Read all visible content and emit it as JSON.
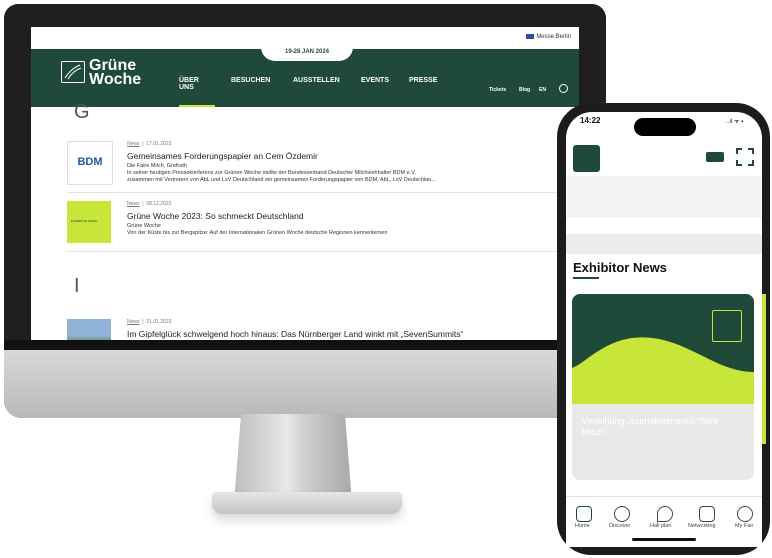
{
  "monitor": {
    "top_link": "Messe Berlin",
    "date_pill": "19-28 JAN 2024",
    "logo_line1": "Grüne",
    "logo_line2": "Woche",
    "nav": [
      "ÜBER UNS",
      "BESUCHEN",
      "AUSSTELLEN",
      "EVENTS",
      "PRESSE"
    ],
    "nav_right": [
      "Tickets",
      "Blog",
      "EN"
    ],
    "section_letters": [
      "G",
      "I"
    ],
    "articles": [
      {
        "thumb": "BDM",
        "category": "News",
        "date": "17.01.2023",
        "title": "Gemeinsames Forderungspapier an Cem Özdemir",
        "author": "Die Faire Milch, Grefrath",
        "text1": "In seiner heutigen Pressekonferenz zur Grünen Woche stellte der Bundesverband Deutscher Milchviehhalter BDM e.V.",
        "text2": "zusammen mit Vertretern von AbL und LsV Deutschland ein gemeinsames Forderungspapier von BDM, AbL, LsV Deutschlan..."
      },
      {
        "thumb": "EXHIBITOR NEWS",
        "category": "News",
        "date": "08.12.2022",
        "title": "Grüne Woche 2023: So schmeckt Deutschland",
        "author": "Grüne Woche",
        "text1": "Von der Küste bis zur Bergspitze: Auf der Internationalen Grünen Woche deutsche Regionen kennenlernen",
        "text2": ""
      },
      {
        "thumb": "",
        "category": "News",
        "date": "21.01.2023",
        "title": "Im Gipfelglück schwelgend hoch hinaus: Das Nürnberger Land winkt mit „SevenSummits“",
        "author": "",
        "text1": "",
        "text2": ""
      }
    ]
  },
  "phone": {
    "time": "14:22",
    "status": "..ıl ᯤ ▪",
    "section_title": "Exhibitor News",
    "card_title": "Verleihung Journalistenpreis \"faire Milch\"",
    "tabs": [
      "Home",
      "Discover",
      "Hall plan",
      "Networking",
      "My Fair"
    ]
  },
  "colors": {
    "brand_green": "#1f4a3a",
    "lime": "#c8e63a"
  }
}
